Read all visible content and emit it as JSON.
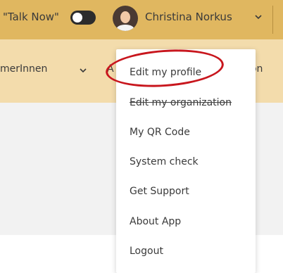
{
  "topbar": {
    "talk_now_label": "\"Talk Now\"",
    "talk_now_enabled": false,
    "user_name": "Christina Norkus",
    "avatar_icon": "user-avatar-icon",
    "user_menu_icon": "chevron-down-icon",
    "background_color": "#e0b760"
  },
  "navbar": {
    "participants_label": "merInnen",
    "participants_icon": "chevron-down-icon",
    "partial_item_label": "A",
    "organization_label": "ation",
    "background_color": "#f3dcac"
  },
  "dropdown_menu": {
    "items": [
      {
        "label": "Edit my profile",
        "highlighted": true
      },
      {
        "label": "Edit my organization",
        "struck_through": true
      },
      {
        "label": "My QR Code"
      },
      {
        "label": "System check"
      },
      {
        "label": "Get Support"
      },
      {
        "label": "About App"
      },
      {
        "label": "Logout"
      }
    ],
    "highlight_color": "#c8161d"
  }
}
